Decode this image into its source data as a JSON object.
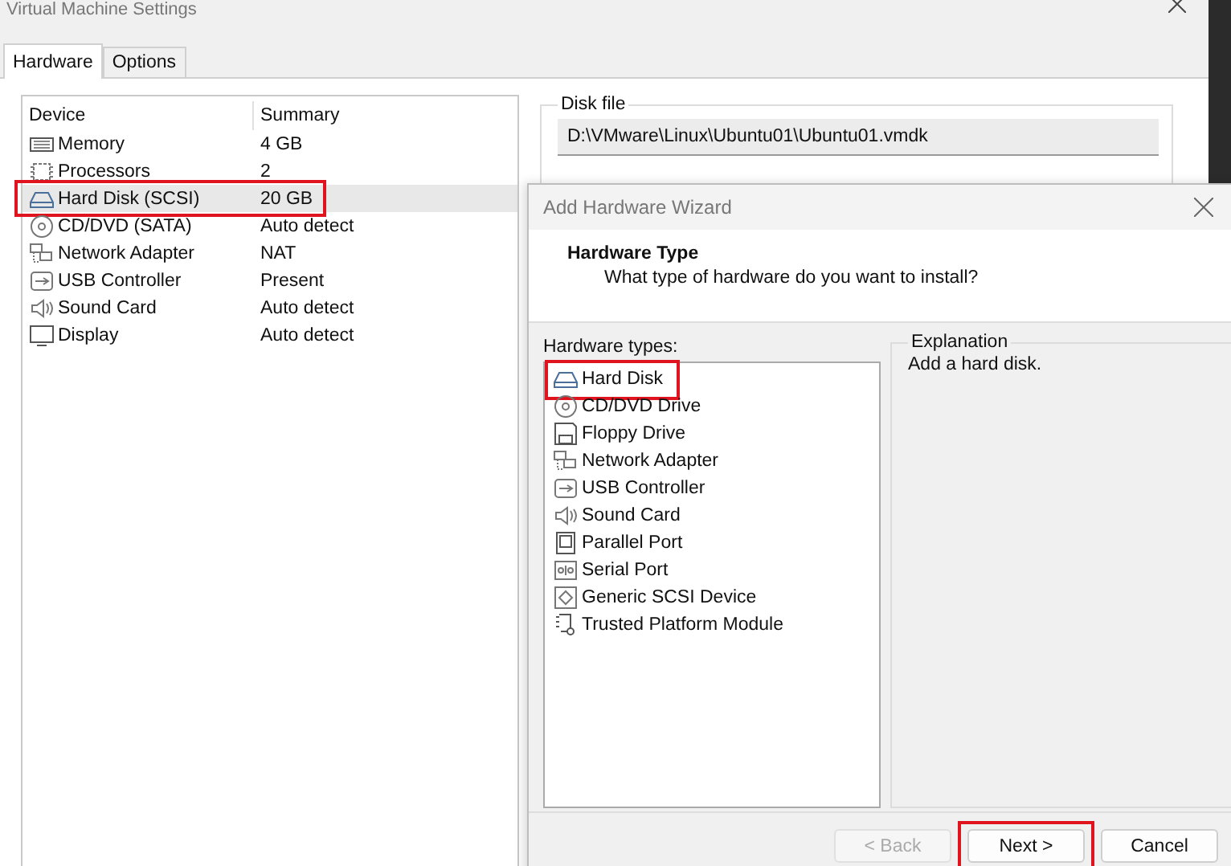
{
  "window": {
    "title": "Virtual Machine Settings"
  },
  "tabs": [
    {
      "label": "Hardware",
      "selected": true
    },
    {
      "label": "Options",
      "selected": false
    }
  ],
  "device_table": {
    "columns": [
      "Device",
      "Summary"
    ],
    "rows": [
      {
        "kind": "memory",
        "device": "Memory",
        "summary": "4 GB",
        "selected": false,
        "annotated": false
      },
      {
        "kind": "cpu",
        "device": "Processors",
        "summary": "2",
        "selected": false,
        "annotated": false
      },
      {
        "kind": "disk",
        "device": "Hard Disk (SCSI)",
        "summary": "20 GB",
        "selected": true,
        "annotated": true
      },
      {
        "kind": "cd",
        "device": "CD/DVD (SATA)",
        "summary": "Auto detect",
        "selected": false,
        "annotated": false
      },
      {
        "kind": "network",
        "device": "Network Adapter",
        "summary": "NAT",
        "selected": false,
        "annotated": false
      },
      {
        "kind": "usb",
        "device": "USB Controller",
        "summary": "Present",
        "selected": false,
        "annotated": false
      },
      {
        "kind": "sound",
        "device": "Sound Card",
        "summary": "Auto detect",
        "selected": false,
        "annotated": false
      },
      {
        "kind": "display",
        "device": "Display",
        "summary": "Auto detect",
        "selected": false,
        "annotated": false
      }
    ]
  },
  "disk_file": {
    "legend": "Disk file",
    "value": "D:\\VMware\\Linux\\Ubuntu01\\Ubuntu01.vmdk"
  },
  "wizard": {
    "title": "Add Hardware Wizard",
    "heading": "Hardware Type",
    "subheading": "What type of hardware do you want to install?",
    "list_label": "Hardware types:",
    "hardware_types": [
      {
        "kind": "disk",
        "label": "Hard Disk",
        "annotated": true
      },
      {
        "kind": "cd",
        "label": "CD/DVD Drive",
        "annotated": false
      },
      {
        "kind": "floppy",
        "label": "Floppy Drive",
        "annotated": false
      },
      {
        "kind": "network",
        "label": "Network Adapter",
        "annotated": false
      },
      {
        "kind": "usb",
        "label": "USB Controller",
        "annotated": false
      },
      {
        "kind": "sound",
        "label": "Sound Card",
        "annotated": false
      },
      {
        "kind": "parallel",
        "label": "Parallel Port",
        "annotated": false
      },
      {
        "kind": "serial",
        "label": "Serial Port",
        "annotated": false
      },
      {
        "kind": "scsi",
        "label": "Generic SCSI Device",
        "annotated": false
      },
      {
        "kind": "tpm",
        "label": "Trusted Platform Module",
        "annotated": false
      }
    ],
    "explanation_legend": "Explanation",
    "explanation": "Add a hard disk.",
    "buttons": [
      {
        "label": "< Back",
        "disabled": true,
        "annotated": false
      },
      {
        "label": "Next >",
        "disabled": false,
        "annotated": true
      },
      {
        "label": "Cancel",
        "disabled": false,
        "annotated": false
      }
    ]
  }
}
